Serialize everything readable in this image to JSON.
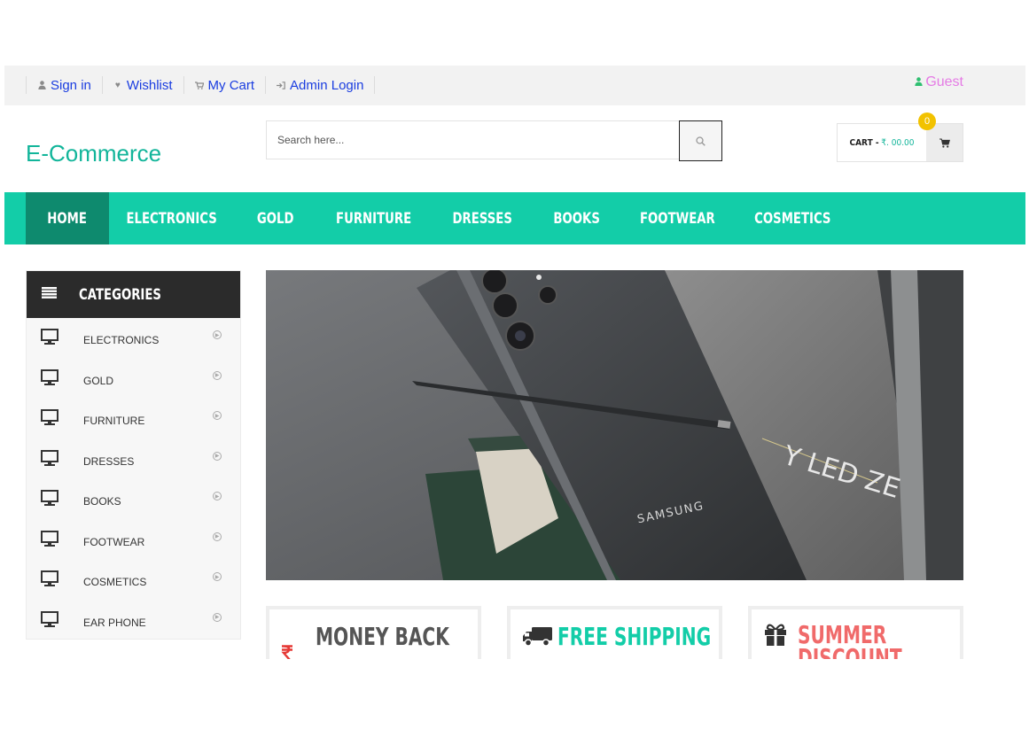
{
  "topbar": {
    "links": [
      {
        "label": "Sign in",
        "icon": "user-icon"
      },
      {
        "label": "Wishlist",
        "icon": "heart-icon"
      },
      {
        "label": "My Cart",
        "icon": "cart-icon"
      },
      {
        "label": "Admin Login",
        "icon": "login-icon"
      }
    ],
    "guest": "Guest"
  },
  "header": {
    "logo": "E-Commerce",
    "search_placeholder": "Search here...",
    "cart_label": "CART -",
    "cart_amount": "₹. 00.00",
    "cart_count": "0"
  },
  "nav": {
    "items": [
      "HOME",
      "ELECTRONICS",
      "GOLD",
      "FURNITURE",
      "DRESSES",
      "BOOKS",
      "FOOTWEAR",
      "COSMETICS"
    ],
    "active": "HOME"
  },
  "categories": {
    "title": "CATEGORIES",
    "items": [
      "ELECTRONICS",
      "GOLD",
      "FURNITURE",
      "DRESSES",
      "BOOKS",
      "FOOTWEAR",
      "COSMETICS",
      "EAR PHONE"
    ]
  },
  "banner": {
    "brand_text": "SAMSUNG",
    "book_text": "Y LED ZE"
  },
  "features": [
    {
      "title": "MONEY BACK",
      "icon": "rupee-icon",
      "color": "#555555"
    },
    {
      "title": "FREE SHIPPING",
      "icon": "truck-icon",
      "color": "#13cda8"
    },
    {
      "title": "SUMMER DISCOUNT",
      "icon": "gift-icon",
      "color": "#f06a6a"
    }
  ],
  "colors": {
    "accent": "#13cda8",
    "accent_dark": "#0e8a6e",
    "link": "#1a3de0",
    "guest": "#e57be5",
    "badge": "#f2c200"
  }
}
